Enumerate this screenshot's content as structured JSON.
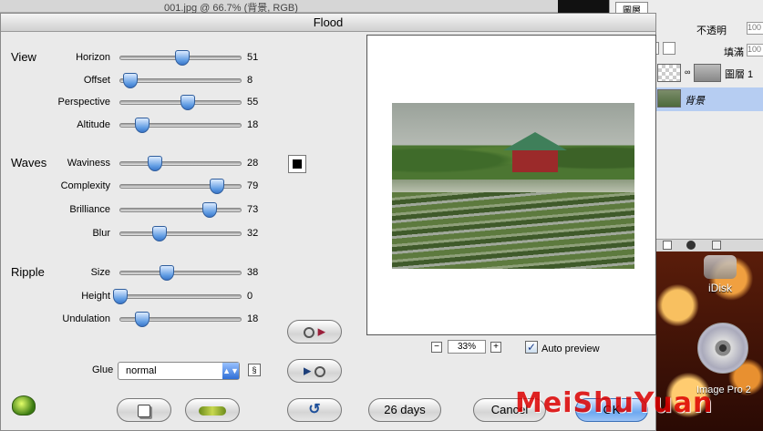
{
  "background": {
    "doc_title": "001.jpg @ 66.7% (背景, RGB)",
    "layers_panel": {
      "tab": "圖層",
      "opacity_label": "不透明",
      "opacity_value": "100",
      "fill_label": "填滿",
      "fill_value": "100",
      "layers": [
        {
          "name": "圖層 1"
        },
        {
          "name": "背景",
          "selected": true
        }
      ]
    },
    "desktop": {
      "idisk_label": "iDisk",
      "cd_label": "Image Pro 2"
    }
  },
  "dialog": {
    "title": "Flood",
    "sections": {
      "view": "View",
      "waves": "Waves",
      "ripple": "Ripple"
    },
    "sliders": {
      "horizon": {
        "label": "Horizon",
        "value": 51
      },
      "offset": {
        "label": "Offset",
        "value": 8
      },
      "perspective": {
        "label": "Perspective",
        "value": 55
      },
      "altitude": {
        "label": "Altitude",
        "value": 18
      },
      "waviness": {
        "label": "Waviness",
        "value": 28
      },
      "complexity": {
        "label": "Complexity",
        "value": 79
      },
      "brilliance": {
        "label": "Brilliance",
        "value": 73
      },
      "blur": {
        "label": "Blur",
        "value": 32
      },
      "size": {
        "label": "Size",
        "value": 38
      },
      "height": {
        "label": "Height",
        "value": 0
      },
      "undulation": {
        "label": "Undulation",
        "value": 18
      }
    },
    "color_swatch": "#000000",
    "glue": {
      "label": "Glue",
      "value": "normal"
    },
    "zoom": {
      "minus": "−",
      "value": "33%",
      "plus": "+"
    },
    "auto_preview": {
      "label": "Auto preview",
      "checked": true
    },
    "buttons": {
      "days": "26 days",
      "cancel": "Cancel",
      "ok": "OK"
    },
    "accent_color": "#5d9ae2"
  },
  "watermark": "MeiShuYuan"
}
